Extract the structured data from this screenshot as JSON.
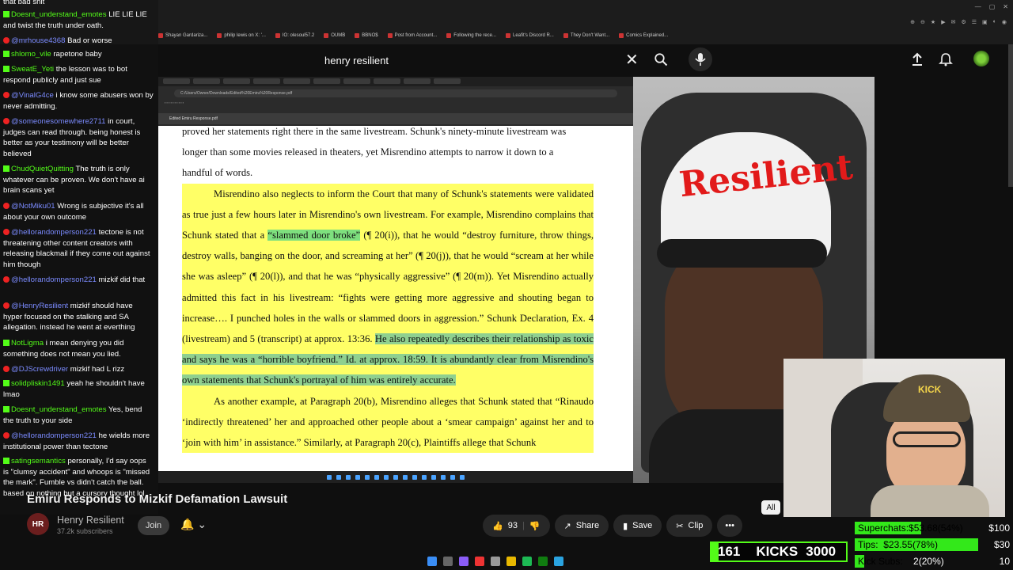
{
  "browser": {
    "bookmarks": [
      "Shayan Gardariza...",
      "philip lewis on X: '...",
      "IO: olesoul57.2",
      "OUMB",
      "BBNO$",
      "Post from Account...",
      "Following the rece...",
      "Leafit's Discord R...",
      "They Don't Want...",
      "Comics Explained..."
    ]
  },
  "youtube": {
    "search_value": "henry resilient",
    "video_title": "Emiru Responds to Mizkif Defamation Lawsuit",
    "channel_name": "Henry Resilient",
    "channel_subs": "37.2k subscribers",
    "channel_initials": "HR",
    "join_label": "Join",
    "like_count": "93",
    "share_label": "Share",
    "save_label": "Save",
    "clip_label": "Clip",
    "filter_all": "All"
  },
  "document": {
    "url": "C:/Users/Owner/Downloads/Edited%20Emiru%20Response.pdf",
    "pdf_title": "Edited Emiru Response.pdf",
    "line1": "proved her statements right there in the same livestream. Schunk's ninety-minute livestream was",
    "line2": "longer than some movies released in theaters, yet Misrendino attempts to narrow it down to a",
    "line3": "handful of words.",
    "p2a": "Misrendino also neglects to inform the Court that many of Schunk's statements were validated as true just a few hours later in Misrendino's own livestream. For example, Misrendino complains that Schunk stated that a ",
    "p2_green": "“slammed door broke”",
    "p2b": " (¶ 20(i)), that he would “destroy furniture, throw things, destroy walls, banging on the door, and screaming at her” (¶ 20(j)), that he would “scream at her while she was asleep” (¶ 20(l)), and that he was “physically aggressive” (¶ 20(m)). Yet Misrendino actually admitted this fact in his livestream: “fights were getting more aggressive and shouting began to increase…. I punched holes in the walls or slammed doors in aggression.” Schunk Declaration, Ex. 4 (livestream) and 5 (transcript) at approx. 13:36. ",
    "p2_green2": "He also repeatedly describes their relationship as toxic and says he was a “horrible boyfriend.” Id. at approx. 18:59. It is abundantly clear from Misrendino's own statements that Schunk's portrayal of him was entirely accurate.",
    "p3": "As another example, at Paragraph 20(b), Misrendino alleges that Schunk stated that “Rinaudo ‘indirectly threatened’ her and approached other people about a ‘smear campaign’ against her and to ‘join with him’ in assistance.” Similarly, at Paragraph 20(c), Plaintiffs allege that Schunk"
  },
  "webcam": {
    "cap_text": "Resilient",
    "small_cap_text": "KICK"
  },
  "chat": [
    {
      "user": "",
      "text": "that bad shit",
      "badge": ""
    },
    {
      "user": "Doesnt_understand_emotes",
      "text": "LIE LIE LIE and twist the truth under oath.",
      "badge": "g"
    },
    {
      "user": "@mrhouse4368",
      "text": "Bad or worse",
      "badge": "r"
    },
    {
      "user": "shlomo_vile",
      "text": "rapetone baby",
      "badge": "g"
    },
    {
      "user": "SweatE_Yeti",
      "text": "the lesson was to bot respond publicly and just sue",
      "badge": "g"
    },
    {
      "user": "@VinalG4ce",
      "text": "i know some abusers won by never admitting.",
      "badge": "r"
    },
    {
      "user": "@someonesomewhere2711",
      "text": "in court, judges can read through. being honest is better as your testimony will be better believed",
      "badge": "r"
    },
    {
      "user": "ChudQuietQuitting",
      "text": "The truth is only whatever can be proven. We don't have ai brain scans yet",
      "badge": "g"
    },
    {
      "user": "@NotMiku01",
      "text": "Wrong is subjective it's all about your own outcome",
      "badge": "r"
    },
    {
      "user": "@hellorandomperson221",
      "text": "tectone is not threatening other content creators with releasing blackmail if they come out against him though",
      "badge": "r"
    },
    {
      "user": "@hellorandomperson221",
      "text": "mizkif did that",
      "badge": "r"
    },
    {
      "user": "@HenryResilient",
      "text": "mizkif should have hyper focused on the stalking and SA allegation. instead he went at everthing",
      "badge": "r"
    },
    {
      "user": "NotLigma",
      "text": "i mean denying you did something does not mean you lied.",
      "badge": "g"
    },
    {
      "user": "@DJScrewdriver",
      "text": "mizkif had L rizz",
      "badge": "r"
    },
    {
      "user": "solidpliskin1491",
      "text": "yeah he shouldn't have lmao",
      "badge": "g"
    },
    {
      "user": "Doesnt_understand_emotes",
      "text": "Yes, bend the truth to your side",
      "badge": "g"
    },
    {
      "user": "@hellorandomperson221",
      "text": "he wields more institutional power than tectone",
      "badge": "r"
    },
    {
      "user": "satingsemantics",
      "text": "personally, I'd say oops is \"clumsy accident\" and whoops is \"missed the mark\". Fumble vs didn't catch the ball. based on nothing but a cursory thought lol",
      "badge": "g"
    }
  ],
  "stream": {
    "kick_count": "161",
    "kicks_label": "KICKS",
    "kick_goal": "3000",
    "superchats_label": "Superchats:",
    "superchats_value": "$53.68(54%)",
    "superchats_goal": "$100",
    "superchats_fraction": 0.54,
    "tips_label": "Tips:",
    "tips_value": "$23.55(78%)",
    "tips_goal": "$30",
    "tips_fraction": 0.78,
    "subs_label": "Kick Subs:",
    "subs_value": "2(20%)",
    "subs_goal": "10",
    "subs_fraction": 0.2,
    "kick_fraction": 0.054
  },
  "colors": {
    "kick_green": "#53fc18",
    "highlight_yellow": "#ffff66",
    "highlight_green": "#7ee07e"
  },
  "icons": [
    "search-icon",
    "mic-icon",
    "upload-icon",
    "bell-icon",
    "like-icon",
    "dislike-icon",
    "share-icon",
    "save-icon",
    "clip-icon",
    "more-icon",
    "close-icon"
  ]
}
